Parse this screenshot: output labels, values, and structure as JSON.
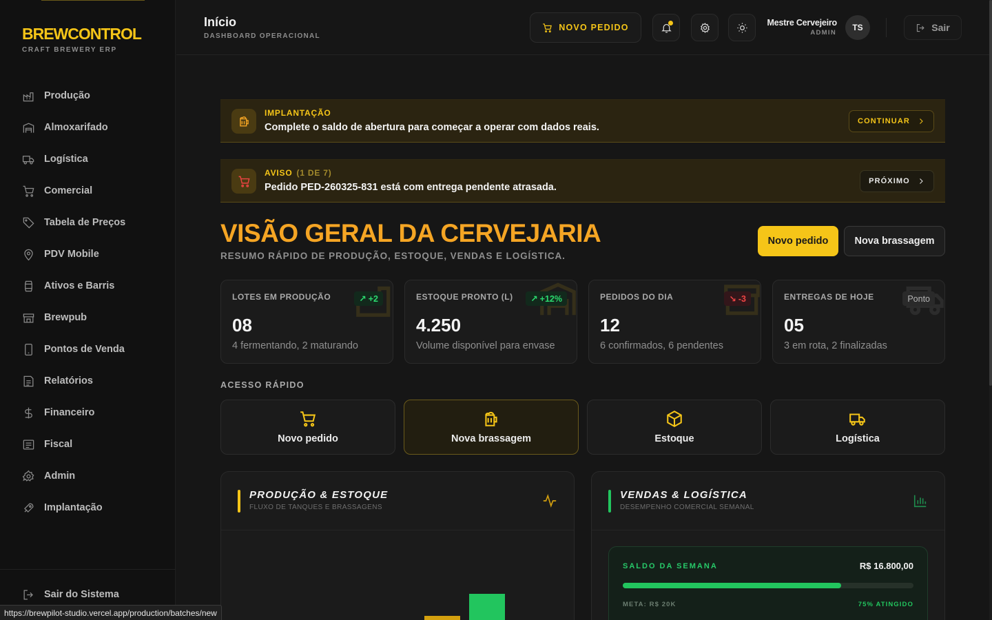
{
  "brand": {
    "logo": "BREWCONTROL",
    "tagline": "CRAFT BREWERY ERP"
  },
  "sidebar": {
    "items": [
      {
        "label": "Produção",
        "icon": "factory-icon"
      },
      {
        "label": "Almoxarifado",
        "icon": "warehouse-icon"
      },
      {
        "label": "Logística",
        "icon": "truck-icon"
      },
      {
        "label": "Comercial",
        "icon": "cart-icon"
      },
      {
        "label": "Tabela de Preços",
        "icon": "tag-icon"
      },
      {
        "label": "PDV Mobile",
        "icon": "map-pin-icon"
      },
      {
        "label": "Ativos e Barris",
        "icon": "barrel-icon"
      },
      {
        "label": "Brewpub",
        "icon": "store-icon"
      },
      {
        "label": "Pontos de Venda",
        "icon": "smartphone-icon"
      },
      {
        "label": "Relatórios",
        "icon": "report-icon"
      },
      {
        "label": "Financeiro",
        "icon": "dollar-icon"
      },
      {
        "label": "Fiscal",
        "icon": "receipt-icon"
      },
      {
        "label": "Admin",
        "icon": "gear-icon"
      },
      {
        "label": "Implantação",
        "icon": "rocket-icon"
      }
    ],
    "logout_label": "Sair do Sistema"
  },
  "header": {
    "title": "Início",
    "subtitle": "DASHBOARD OPERACIONAL",
    "new_order_label": "NOVO PEDIDO",
    "user_name": "Mestre Cervejeiro",
    "user_role": "ADMIN",
    "avatar_initials": "TS",
    "logout_label": "Sair"
  },
  "banners": {
    "setup": {
      "title": "IMPLANTAÇÃO",
      "text": "Complete o saldo de abertura para começar a operar com dados reais.",
      "button": "CONTINUAR"
    },
    "notice": {
      "title": "AVISO",
      "count": "(1 DE 7)",
      "text": "Pedido PED-260325-831 está com entrega pendente atrasada.",
      "button": "PRÓXIMO"
    }
  },
  "hero": {
    "title": "VISÃO GERAL DA CERVEJARIA",
    "subtitle": "RESUMO RÁPIDO DE PRODUÇÃO, ESTOQUE, VENDAS E LOGÍSTICA.",
    "primary_button": "Novo pedido",
    "secondary_button": "Nova brassagem"
  },
  "kpis": [
    {
      "label": "LOTES EM PRODUÇÃO",
      "value": "08",
      "desc": "4 fermentando, 2 maturando",
      "badge": "+2",
      "trend": "up"
    },
    {
      "label": "ESTOQUE PRONTO (L)",
      "value": "4.250",
      "desc": "Volume disponível para envase",
      "badge": "+12%",
      "trend": "up"
    },
    {
      "label": "PEDIDOS DO DIA",
      "value": "12",
      "desc": "6 confirmados, 6 pendentes",
      "badge": "-3",
      "trend": "down"
    },
    {
      "label": "ENTREGAS DE HOJE",
      "value": "05",
      "desc": "3 em rota, 2 finalizadas",
      "badge": "Ponto",
      "trend": "neutral"
    }
  ],
  "quick_access": {
    "title": "ACESSO RÁPIDO",
    "items": [
      {
        "label": "Novo pedido",
        "icon": "cart-icon"
      },
      {
        "label": "Nova brassagem",
        "icon": "beer-icon"
      },
      {
        "label": "Estoque",
        "icon": "box-icon"
      },
      {
        "label": "Logística",
        "icon": "truck-icon"
      }
    ]
  },
  "panels": {
    "production": {
      "title": "PRODUÇÃO & ESTOQUE",
      "subtitle": "FLUXO DE TANQUES E BRASSAGENS"
    },
    "sales": {
      "title": "VENDAS & LOGÍSTICA",
      "subtitle": "DESEMPENHO COMERCIAL SEMANAL",
      "week_label": "SALDO DA SEMANA",
      "week_value": "R$ 16.800,00",
      "goal_label": "META: R$ 20K",
      "progress_label": "75% ATINGIDO",
      "progress": 0.75
    }
  },
  "chart_data": {
    "type": "bar",
    "values": [
      0.5,
      1.6,
      3.2,
      0.3
    ],
    "colors": [
      "#d4a00e",
      "#d4a00e",
      "#22c55e",
      "#d4a00e"
    ]
  },
  "status_url": "https://brewpilot-studio.vercel.app/production/batches/new",
  "colors": {
    "accent": "#f5c518",
    "hero": "#f5a524",
    "success": "#22c55e",
    "danger": "#ef4444"
  }
}
